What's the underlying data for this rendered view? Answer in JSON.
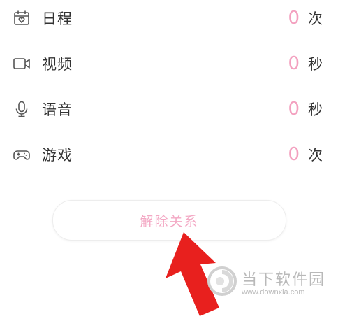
{
  "stats": {
    "schedule": {
      "icon": "calendar-heart-icon",
      "label": "日程",
      "value": "0",
      "unit": "次"
    },
    "video": {
      "icon": "video-camera-icon",
      "label": "视频",
      "value": "0",
      "unit": "秒"
    },
    "voice": {
      "icon": "microphone-icon",
      "label": "语音",
      "value": "0",
      "unit": "秒"
    },
    "game": {
      "icon": "gamepad-icon",
      "label": "游戏",
      "value": "0",
      "unit": "次"
    }
  },
  "actions": {
    "unbind_label": "解除关系"
  },
  "watermark": {
    "title": "当下软件园",
    "url": "www.downxia.com"
  },
  "colors": {
    "accent_pink": "#f3a0bf",
    "arrow_red": "#e8201e",
    "text": "#333333"
  }
}
